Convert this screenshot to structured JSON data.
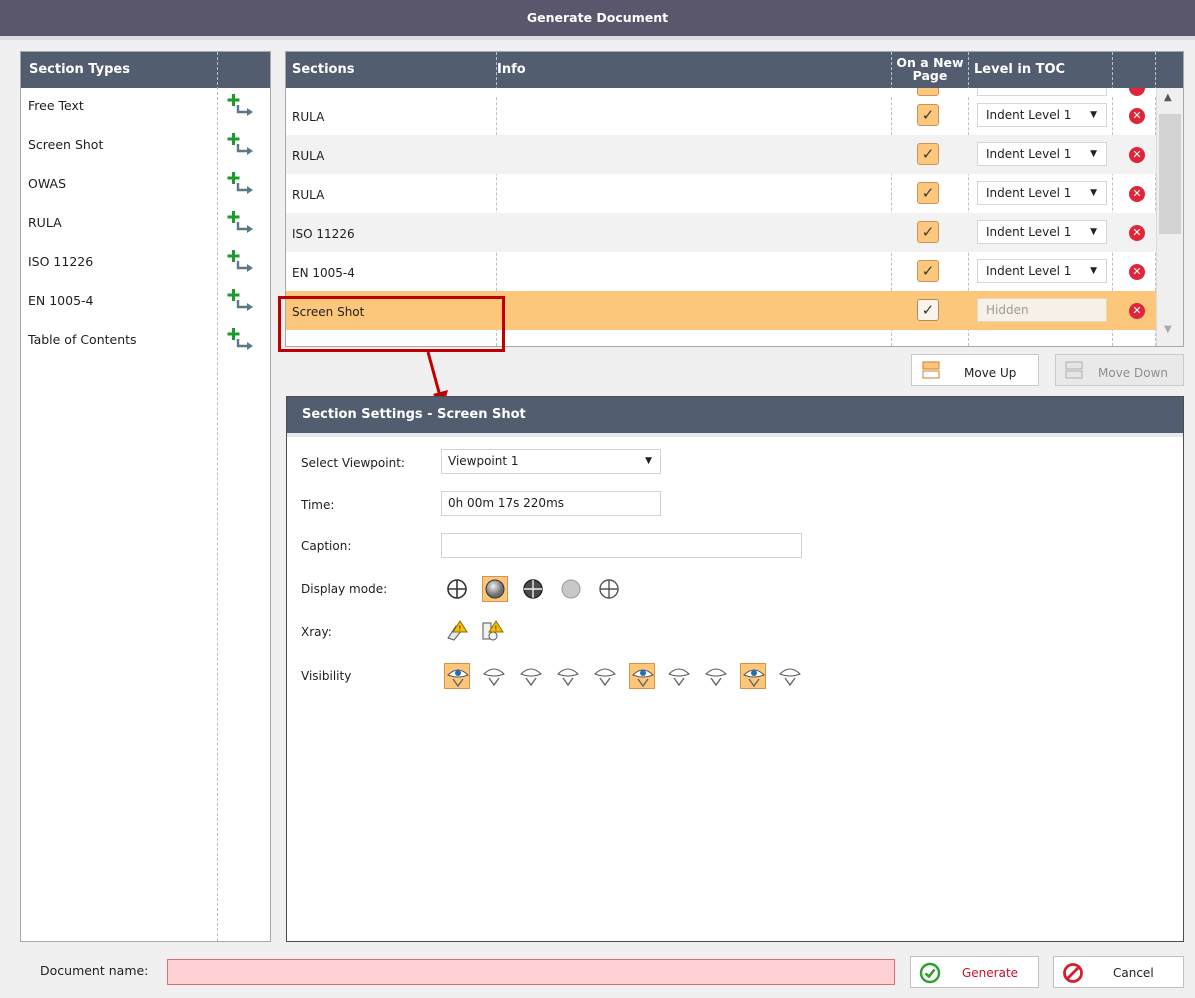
{
  "window": {
    "title": "Generate Document"
  },
  "section_types": {
    "header": "Section Types",
    "items": [
      {
        "label": "Free Text"
      },
      {
        "label": "Screen Shot"
      },
      {
        "label": "OWAS"
      },
      {
        "label": "RULA"
      },
      {
        "label": "ISO 11226"
      },
      {
        "label": "EN 1005-4"
      },
      {
        "label": "Table of Contents"
      }
    ]
  },
  "sections": {
    "headers": {
      "sections": "Sections",
      "info": "Info",
      "new_page_line1": "On a New",
      "new_page_line2": "Page",
      "level": "Level in TOC"
    },
    "rows": [
      {
        "name": "RULA",
        "info": "",
        "new_page": true,
        "level": "Indent Level 1",
        "selected": false
      },
      {
        "name": "RULA",
        "info": "",
        "new_page": true,
        "level": "Indent Level 1",
        "selected": false
      },
      {
        "name": "RULA",
        "info": "",
        "new_page": true,
        "level": "Indent Level 1",
        "selected": false
      },
      {
        "name": "ISO 11226",
        "info": "",
        "new_page": true,
        "level": "Indent Level 1",
        "selected": false
      },
      {
        "name": "EN 1005-4",
        "info": "",
        "new_page": true,
        "level": "Indent Level 1",
        "selected": false
      },
      {
        "name": "Screen Shot",
        "info": "",
        "new_page": true,
        "level": "Hidden",
        "selected": true
      }
    ]
  },
  "move_buttons": {
    "up": "Move Up",
    "down": "Move Down"
  },
  "settings": {
    "title": "Section Settings - Screen Shot",
    "viewpoint_label": "Select Viewpoint:",
    "viewpoint_value": "Viewpoint 1",
    "time_label": "Time:",
    "time_value": "0h 00m 17s 220ms",
    "caption_label": "Caption:",
    "caption_value": "",
    "display_mode_label": "Display mode:",
    "display_modes": [
      "wireframe",
      "shaded",
      "shaded-with-edges",
      "hidden-line-gray",
      "outline"
    ],
    "display_mode_active": 1,
    "xray_label": "Xray:",
    "xray_icons": [
      "xray-human-icon",
      "xray-objects-icon"
    ],
    "visibility_label": "Visibility",
    "visibility_icons": [
      "humans",
      "geometry",
      "surfaces",
      "frames",
      "joints",
      "points",
      "constraints",
      "vectors",
      "grid",
      "other"
    ],
    "visibility_active": [
      0,
      5,
      8
    ]
  },
  "footer": {
    "doc_name_label": "Document name:",
    "doc_name_value": "",
    "generate": "Generate",
    "cancel": "Cancel"
  },
  "colors": {
    "title_bar": "#5a566b",
    "grid_header": "#535d70",
    "selected_row": "#fcc77b",
    "delete": "#e0253b",
    "annotation": "#c00000"
  }
}
